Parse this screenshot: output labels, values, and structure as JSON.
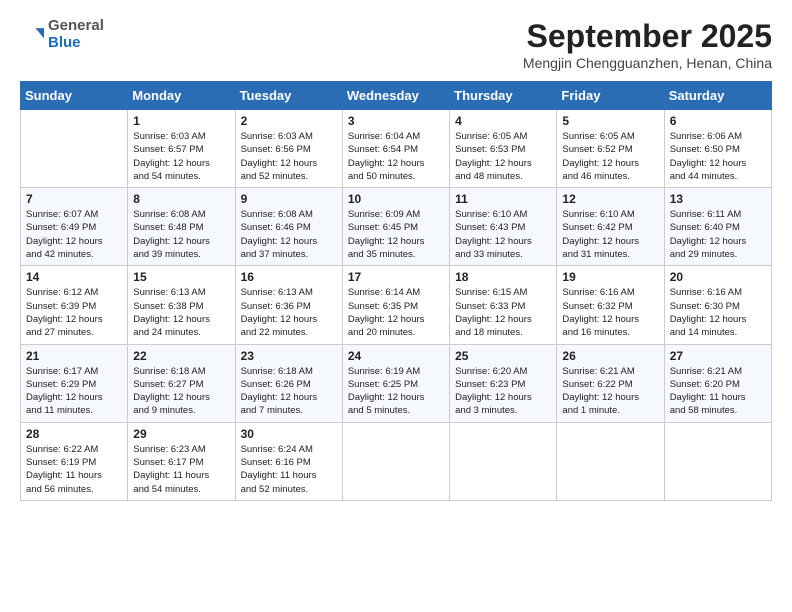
{
  "logo": {
    "general": "General",
    "blue": "Blue"
  },
  "header": {
    "month": "September 2025",
    "location": "Mengjin Chengguanzhen, Henan, China"
  },
  "days_of_week": [
    "Sunday",
    "Monday",
    "Tuesday",
    "Wednesday",
    "Thursday",
    "Friday",
    "Saturday"
  ],
  "weeks": [
    [
      {
        "day": "",
        "info": ""
      },
      {
        "day": "1",
        "info": "Sunrise: 6:03 AM\nSunset: 6:57 PM\nDaylight: 12 hours\nand 54 minutes."
      },
      {
        "day": "2",
        "info": "Sunrise: 6:03 AM\nSunset: 6:56 PM\nDaylight: 12 hours\nand 52 minutes."
      },
      {
        "day": "3",
        "info": "Sunrise: 6:04 AM\nSunset: 6:54 PM\nDaylight: 12 hours\nand 50 minutes."
      },
      {
        "day": "4",
        "info": "Sunrise: 6:05 AM\nSunset: 6:53 PM\nDaylight: 12 hours\nand 48 minutes."
      },
      {
        "day": "5",
        "info": "Sunrise: 6:05 AM\nSunset: 6:52 PM\nDaylight: 12 hours\nand 46 minutes."
      },
      {
        "day": "6",
        "info": "Sunrise: 6:06 AM\nSunset: 6:50 PM\nDaylight: 12 hours\nand 44 minutes."
      }
    ],
    [
      {
        "day": "7",
        "info": "Sunrise: 6:07 AM\nSunset: 6:49 PM\nDaylight: 12 hours\nand 42 minutes."
      },
      {
        "day": "8",
        "info": "Sunrise: 6:08 AM\nSunset: 6:48 PM\nDaylight: 12 hours\nand 39 minutes."
      },
      {
        "day": "9",
        "info": "Sunrise: 6:08 AM\nSunset: 6:46 PM\nDaylight: 12 hours\nand 37 minutes."
      },
      {
        "day": "10",
        "info": "Sunrise: 6:09 AM\nSunset: 6:45 PM\nDaylight: 12 hours\nand 35 minutes."
      },
      {
        "day": "11",
        "info": "Sunrise: 6:10 AM\nSunset: 6:43 PM\nDaylight: 12 hours\nand 33 minutes."
      },
      {
        "day": "12",
        "info": "Sunrise: 6:10 AM\nSunset: 6:42 PM\nDaylight: 12 hours\nand 31 minutes."
      },
      {
        "day": "13",
        "info": "Sunrise: 6:11 AM\nSunset: 6:40 PM\nDaylight: 12 hours\nand 29 minutes."
      }
    ],
    [
      {
        "day": "14",
        "info": "Sunrise: 6:12 AM\nSunset: 6:39 PM\nDaylight: 12 hours\nand 27 minutes."
      },
      {
        "day": "15",
        "info": "Sunrise: 6:13 AM\nSunset: 6:38 PM\nDaylight: 12 hours\nand 24 minutes."
      },
      {
        "day": "16",
        "info": "Sunrise: 6:13 AM\nSunset: 6:36 PM\nDaylight: 12 hours\nand 22 minutes."
      },
      {
        "day": "17",
        "info": "Sunrise: 6:14 AM\nSunset: 6:35 PM\nDaylight: 12 hours\nand 20 minutes."
      },
      {
        "day": "18",
        "info": "Sunrise: 6:15 AM\nSunset: 6:33 PM\nDaylight: 12 hours\nand 18 minutes."
      },
      {
        "day": "19",
        "info": "Sunrise: 6:16 AM\nSunset: 6:32 PM\nDaylight: 12 hours\nand 16 minutes."
      },
      {
        "day": "20",
        "info": "Sunrise: 6:16 AM\nSunset: 6:30 PM\nDaylight: 12 hours\nand 14 minutes."
      }
    ],
    [
      {
        "day": "21",
        "info": "Sunrise: 6:17 AM\nSunset: 6:29 PM\nDaylight: 12 hours\nand 11 minutes."
      },
      {
        "day": "22",
        "info": "Sunrise: 6:18 AM\nSunset: 6:27 PM\nDaylight: 12 hours\nand 9 minutes."
      },
      {
        "day": "23",
        "info": "Sunrise: 6:18 AM\nSunset: 6:26 PM\nDaylight: 12 hours\nand 7 minutes."
      },
      {
        "day": "24",
        "info": "Sunrise: 6:19 AM\nSunset: 6:25 PM\nDaylight: 12 hours\nand 5 minutes."
      },
      {
        "day": "25",
        "info": "Sunrise: 6:20 AM\nSunset: 6:23 PM\nDaylight: 12 hours\nand 3 minutes."
      },
      {
        "day": "26",
        "info": "Sunrise: 6:21 AM\nSunset: 6:22 PM\nDaylight: 12 hours\nand 1 minute."
      },
      {
        "day": "27",
        "info": "Sunrise: 6:21 AM\nSunset: 6:20 PM\nDaylight: 11 hours\nand 58 minutes."
      }
    ],
    [
      {
        "day": "28",
        "info": "Sunrise: 6:22 AM\nSunset: 6:19 PM\nDaylight: 11 hours\nand 56 minutes."
      },
      {
        "day": "29",
        "info": "Sunrise: 6:23 AM\nSunset: 6:17 PM\nDaylight: 11 hours\nand 54 minutes."
      },
      {
        "day": "30",
        "info": "Sunrise: 6:24 AM\nSunset: 6:16 PM\nDaylight: 11 hours\nand 52 minutes."
      },
      {
        "day": "",
        "info": ""
      },
      {
        "day": "",
        "info": ""
      },
      {
        "day": "",
        "info": ""
      },
      {
        "day": "",
        "info": ""
      }
    ]
  ]
}
